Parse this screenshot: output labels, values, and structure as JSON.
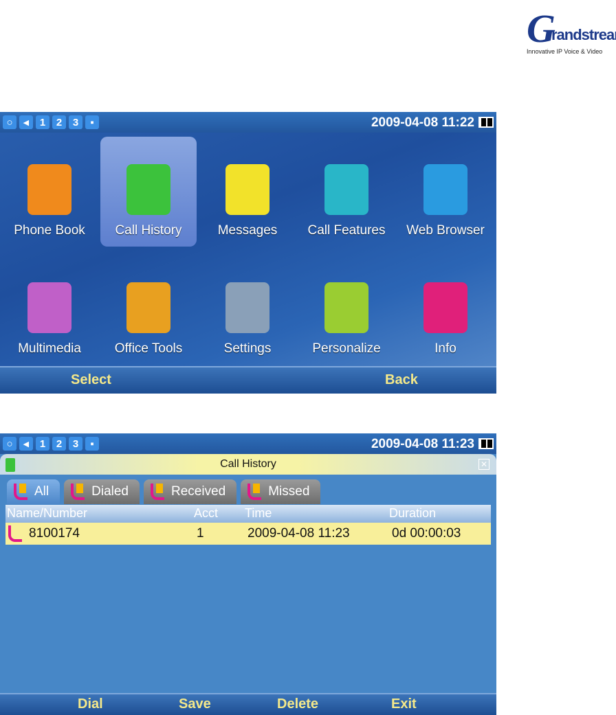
{
  "logo": {
    "brand": "Grandstream",
    "tagline": "Innovative IP Voice & Video"
  },
  "status_icons": [
    "1",
    "2",
    "3"
  ],
  "screen1": {
    "clock": "2009-04-08 11:22",
    "menu": [
      {
        "label": "Phone Book",
        "color": "#f08a1c"
      },
      {
        "label": "Call History",
        "color": "#3cc23c"
      },
      {
        "label": "Messages",
        "color": "#f2e22a"
      },
      {
        "label": "Call Features",
        "color": "#29b6c8"
      },
      {
        "label": "Web Browser",
        "color": "#2a9be0"
      },
      {
        "label": "Multimedia",
        "color": "#c060c8"
      },
      {
        "label": "Office Tools",
        "color": "#e8a020"
      },
      {
        "label": "Settings",
        "color": "#8aa0b8"
      },
      {
        "label": "Personalize",
        "color": "#9acd32"
      },
      {
        "label": "Info",
        "color": "#e0207a"
      }
    ],
    "softkeys": {
      "left": "Select",
      "right": "Back"
    }
  },
  "screen2": {
    "clock": "2009-04-08 11:23",
    "title": "Call History",
    "tabs": [
      "All",
      "Dialed",
      "Received",
      "Missed"
    ],
    "columns": [
      "Name/Number",
      "Acct",
      "Time",
      "Duration"
    ],
    "rows": [
      {
        "number": "8100174",
        "acct": "1",
        "time": "2009-04-08 11:23",
        "duration": "0d 00:00:03"
      }
    ],
    "softkeys": [
      "Dial",
      "Save",
      "Delete",
      "Exit"
    ]
  }
}
